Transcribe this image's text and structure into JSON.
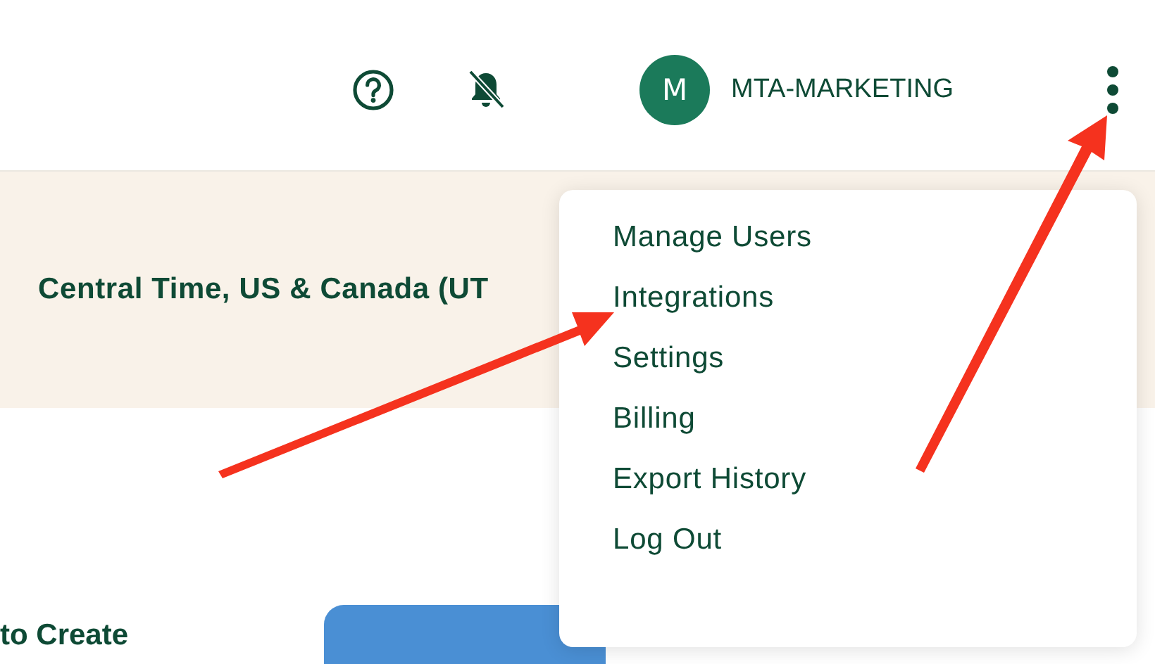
{
  "header": {
    "avatar_initial": "M",
    "account_name": "MTA-MARKETING"
  },
  "banner": {
    "timezone": "Central Time, US & Canada (UT"
  },
  "content": {
    "text": "to Create"
  },
  "menu": {
    "items": [
      {
        "label": "Manage Users"
      },
      {
        "label": "Integrations"
      },
      {
        "label": "Settings"
      },
      {
        "label": "Billing"
      },
      {
        "label": "Export History"
      },
      {
        "label": "Log Out"
      }
    ]
  }
}
